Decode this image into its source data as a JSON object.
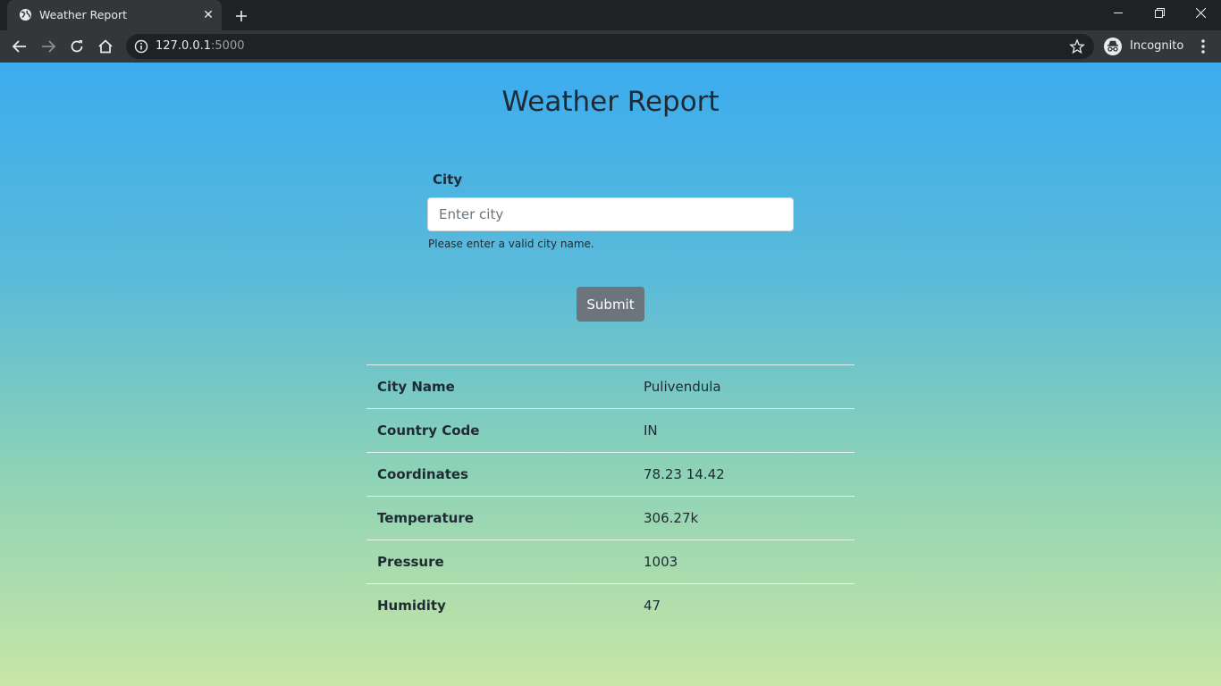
{
  "browser": {
    "tab_title": "Weather Report",
    "url_host": "127.0.0.1",
    "url_port": ":5000",
    "profile_label": "Incognito"
  },
  "page": {
    "title": "Weather Report",
    "form": {
      "city_label": "City",
      "city_placeholder": "Enter city",
      "city_value": "",
      "helper_text": "Please enter a valid city name.",
      "submit_label": "Submit"
    },
    "results": [
      {
        "key": "City Name",
        "value": "Pulivendula"
      },
      {
        "key": "Country Code",
        "value": "IN"
      },
      {
        "key": "Coordinates",
        "value": "78.23 14.42"
      },
      {
        "key": "Temperature",
        "value": "306.27k"
      },
      {
        "key": "Pressure",
        "value": "1003"
      },
      {
        "key": "Humidity",
        "value": "47"
      }
    ]
  },
  "colors": {
    "gradient_top": "#3cacef",
    "gradient_bottom": "#c8e6a5",
    "submit_button": "#6c757d",
    "chrome_dark": "#202124",
    "chrome_toolbar": "#35363a"
  }
}
